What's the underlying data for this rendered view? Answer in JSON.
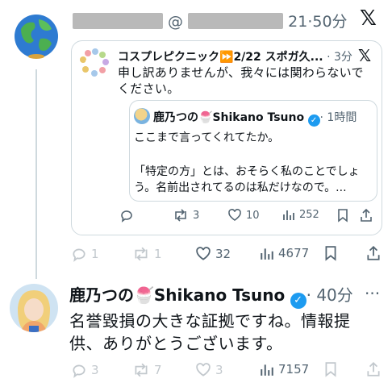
{
  "header": {
    "at_sign": "@",
    "time": "21·50分",
    "x_logo": "𝕏"
  },
  "quoted": {
    "account_name": "コスプレピクニック",
    "ff_glyph": "⏩",
    "headline": "2/22 スポガ久...",
    "time": "· 3分",
    "x_logo": "𝕏",
    "text": "申し訳ありませんが、我々には関わらないでください。",
    "stats": {
      "reply": "",
      "retweet": "3",
      "like": "10",
      "views": "252"
    }
  },
  "inner_quote": {
    "name": "鹿乃つの",
    "dessert_emoji": "🍧",
    "handle_name": "Shikano Tsuno",
    "time": "· 1時間",
    "line1": "ここまで言ってくれてたか。",
    "line2": "「特定の方」とは、おそらく私のことでしょ",
    "line3": "う。名前出されてるのは私だけなので。..."
  },
  "outer_stats": {
    "reply": "1",
    "retweet": "1",
    "like": "32",
    "views": "4677"
  },
  "reply_tweet": {
    "name": "鹿乃つの",
    "dessert_emoji": "🍧",
    "handle_name": "Shikano Tsuno",
    "time": "· 40分",
    "more": "···",
    "line1": "名誉毀損の大きな証拠ですね。情報提",
    "line2": "供、ありがとうございます。",
    "stats": {
      "reply": "3",
      "retweet": "7",
      "like": "3",
      "views": "7157"
    }
  },
  "colors": {
    "verified": "#1d9bf0",
    "border": "#cfd9de",
    "muted": "#536471"
  }
}
